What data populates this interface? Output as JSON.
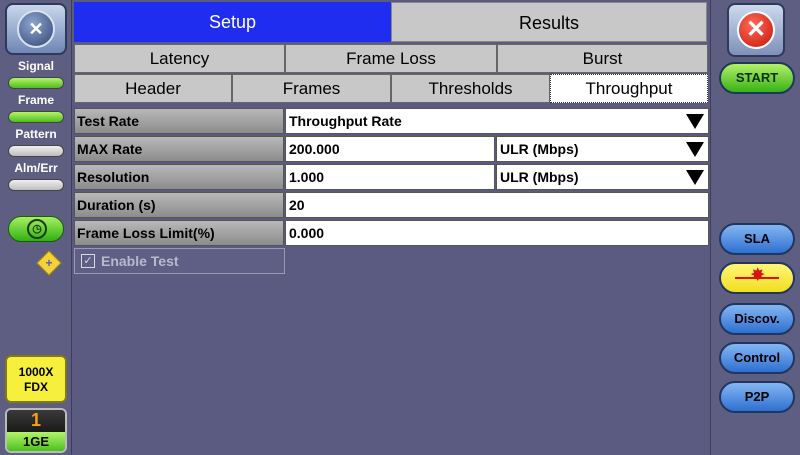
{
  "left": {
    "signal_label": "Signal",
    "frame_label": "Frame",
    "pattern_label": "Pattern",
    "almerr_label": "Alm/Err",
    "fdx_line1": "1000X",
    "fdx_line2": "FDX",
    "port_number": "1",
    "port_speed": "1GE"
  },
  "tabs": {
    "top": [
      "Setup",
      "Results"
    ],
    "row1": [
      "Latency",
      "Frame Loss",
      "Burst"
    ],
    "row2": [
      "Header",
      "Frames",
      "Thresholds",
      "Throughput"
    ]
  },
  "form": {
    "test_rate": {
      "label": "Test Rate",
      "value": "Throughput Rate"
    },
    "max_rate": {
      "label": "MAX Rate",
      "value": "200.000",
      "unit": "ULR (Mbps)"
    },
    "resolution": {
      "label": "Resolution",
      "value": "1.000",
      "unit": "ULR (Mbps)"
    },
    "duration": {
      "label": "Duration (s)",
      "value": "20"
    },
    "frame_loss_limit": {
      "label": "Frame Loss Limit(%)",
      "value": "0.000"
    },
    "enable_test": {
      "label": "Enable Test",
      "checked": true
    }
  },
  "right": {
    "start_label": "START",
    "sla_label": "SLA",
    "discov_label": "Discov.",
    "control_label": "Control",
    "p2p_label": "P2P"
  }
}
